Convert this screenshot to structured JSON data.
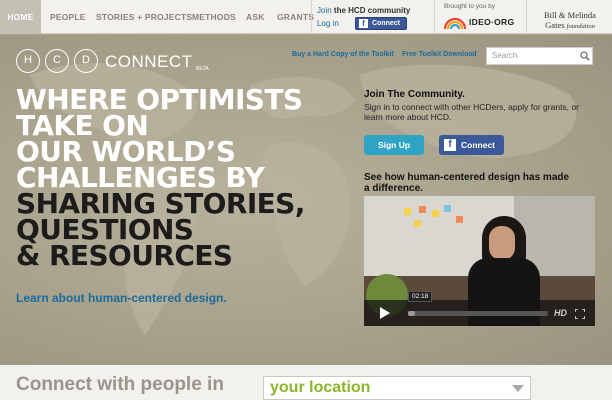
{
  "nav": {
    "items": [
      {
        "key": "home",
        "label": "HOME"
      },
      {
        "key": "people",
        "label": "PEOPLE"
      },
      {
        "key": "stories",
        "label": "STORIES + PROJECTS"
      },
      {
        "key": "methods",
        "label": "METHODS"
      },
      {
        "key": "ask",
        "label": "ASK"
      },
      {
        "key": "grants",
        "label": "GRANTS"
      }
    ],
    "join_prefix": "Join",
    "join_community": "the HCD community",
    "login": "Log in",
    "fb_connect": "Connect",
    "brought_by": "Brought to you by",
    "ideo": "IDEO·ORG",
    "gates_line1": "Bill & Melinda",
    "gates_line2": "Gates",
    "gates_foundation": "foundation"
  },
  "hero": {
    "logo_letters": [
      "H",
      "C",
      "D"
    ],
    "logo_word": "CONNECT",
    "logo_beta": "BETA",
    "link_toolkit": "Buy a Hard Copy of the Toolkit",
    "link_download": "Free Toolkit Download",
    "search_placeholder": "Search",
    "headline_white": [
      "WHERE OPTIMISTS",
      "TAKE ON",
      "OUR WORLD’S",
      "CHALLENGES BY"
    ],
    "headline_dark": [
      "SHARING STORIES,",
      "QUESTIONS",
      "& RESOURCES"
    ],
    "learn_link": "Learn about human-centered design."
  },
  "side": {
    "title": "Join The Community.",
    "text": "Sign in to connect with other HCDers, apply for grants, or learn more about HCD.",
    "signup": "Sign Up",
    "connect": "Connect",
    "see_how": "See how human-centered design has made a difference."
  },
  "video": {
    "time": "02:18",
    "hd": "HD",
    "progress": 0.05
  },
  "bottom": {
    "connect_label": "Connect with people in",
    "location": "your location"
  },
  "colors": {
    "link": "#1a6b9c",
    "signup": "#2fa4c4",
    "facebook": "#3b5998",
    "location_text": "#8bb52c"
  }
}
